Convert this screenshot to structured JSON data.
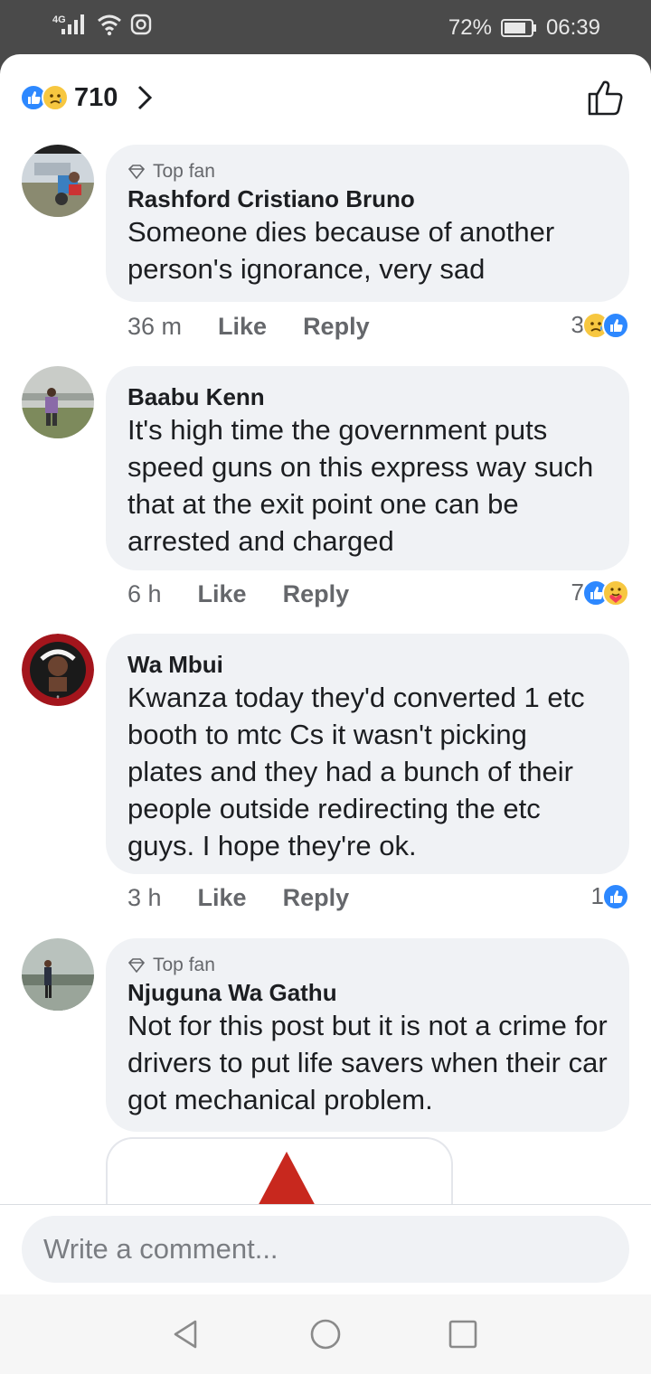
{
  "status_bar": {
    "network": "4G",
    "battery": "72%",
    "time": "06:39"
  },
  "reactions_header": {
    "count": "710",
    "icons": [
      "like-icon",
      "sad-icon"
    ]
  },
  "comments": [
    {
      "top_fan_label": "Top fan",
      "name": "Rashford Cristiano Bruno",
      "text": "Someone dies because of another person's ignorance,  very sad",
      "time": "36 m",
      "like_label": "Like",
      "reply_label": "Reply",
      "reaction_count": "3",
      "reaction_icons": [
        "sad-icon",
        "like-icon"
      ]
    },
    {
      "name": "Baabu Kenn",
      "text": "It's high time the government puts speed guns on this express way such that at the exit point one can be arrested and charged",
      "time": "6 h",
      "like_label": "Like",
      "reply_label": "Reply",
      "reaction_count": "7",
      "reaction_icons": [
        "like-icon",
        "care-icon"
      ]
    },
    {
      "name": "Wa Mbui",
      "text": "Kwanza today they'd converted 1 etc booth to mtc Cs it wasn't picking plates and they had a bunch of their people outside redirecting the etc guys. I hope they're ok.",
      "time": "3 h",
      "like_label": "Like",
      "reply_label": "Reply",
      "reaction_count": "1",
      "reaction_icons": [
        "like-icon"
      ]
    },
    {
      "top_fan_label": "Top fan",
      "name": "Njuguna Wa Gathu",
      "text": "Not for this post but it is not a crime for drivers to put life savers when their car got mechanical problem."
    }
  ],
  "composer": {
    "placeholder": "Write a comment..."
  },
  "colors": {
    "accent": "#2d88ff",
    "bubble": "#f0f2f5",
    "muted_text": "#65676b",
    "text": "#1c1e21"
  }
}
